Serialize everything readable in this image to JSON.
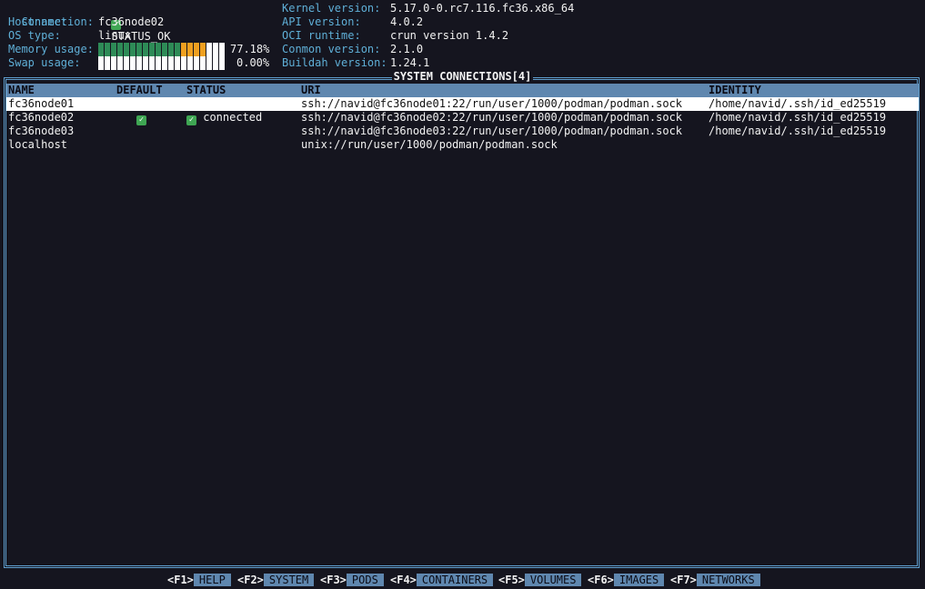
{
  "info_left": {
    "connection_label": "Connection:",
    "connection_value": "STATUS_OK",
    "hostname_label": "Hostname:",
    "hostname_value": "fc36node02",
    "ostype_label": "OS type:",
    "ostype_value": "linux",
    "memory_label": "Memory usage:",
    "memory_percent": "77.18%",
    "memory_fraction": 0.7718,
    "swap_label": "Swap usage:",
    "swap_percent": "0.00%",
    "swap_fraction": 0.0
  },
  "info_right": {
    "kernel_label": "Kernel version:",
    "kernel_value": "5.17.0-0.rc7.116.fc36.x86_64",
    "api_label": "API version:",
    "api_value": "4.0.2",
    "oci_label": "OCI runtime:",
    "oci_value": "crun version 1.4.2",
    "conmon_label": "Conmon version:",
    "conmon_value": "2.1.0",
    "buildah_label": "Buildah version:",
    "buildah_value": "1.24.1"
  },
  "panel": {
    "title": "SYSTEM CONNECTIONS[4]"
  },
  "table": {
    "headers": {
      "name": "NAME",
      "default": "DEFAULT",
      "status": "STATUS",
      "uri": "URI",
      "identity": "IDENTITY"
    },
    "rows": [
      {
        "name": "fc36node01",
        "default": "",
        "status": "",
        "uri": "ssh://navid@fc36node01:22/run/user/1000/podman/podman.sock",
        "identity": "/home/navid/.ssh/id_ed25519"
      },
      {
        "name": "fc36node02",
        "default": "yes",
        "status": "connected",
        "uri": "ssh://navid@fc36node02:22/run/user/1000/podman/podman.sock",
        "identity": "/home/navid/.ssh/id_ed25519"
      },
      {
        "name": "fc36node03",
        "default": "",
        "status": "",
        "uri": "ssh://navid@fc36node03:22/run/user/1000/podman/podman.sock",
        "identity": "/home/navid/.ssh/id_ed25519"
      },
      {
        "name": "localhost",
        "default": "",
        "status": "",
        "uri": "unix://run/user/1000/podman/podman.sock",
        "identity": ""
      }
    ]
  },
  "footer": {
    "f1_key": "<F1>",
    "f1_label": "HELP",
    "f2_key": "<F2>",
    "f2_label": "SYSTEM",
    "f3_key": "<F3>",
    "f3_label": "PODS",
    "f4_key": "<F4>",
    "f4_label": "CONTAINERS",
    "f5_key": "<F5>",
    "f5_label": "VOLUMES",
    "f6_key": "<F6>",
    "f6_label": "IMAGES",
    "f7_key": "<F7>",
    "f7_label": "NETWORKS"
  },
  "colors": {
    "background": "#15151f",
    "label": "#5fafd7",
    "header_bg": "#5f87af",
    "bar_green": "#2e8b57",
    "bar_orange": "#f0a020",
    "check_green": "#3fa653"
  },
  "icons": {
    "status_ok": "check-icon"
  }
}
